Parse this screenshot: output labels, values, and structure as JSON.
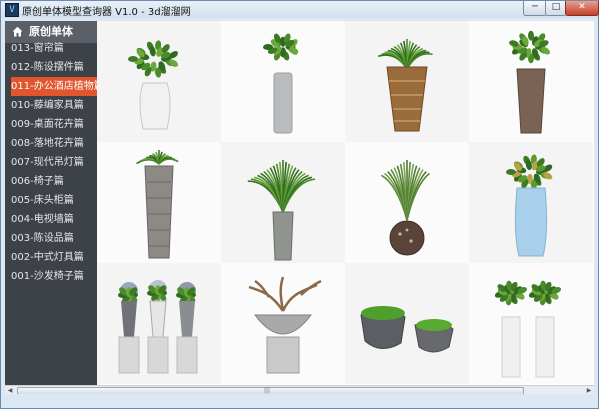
{
  "window": {
    "title": "原创单体模型查询器 V1.0 - 3d溜溜网",
    "min_glyph": "─",
    "max_glyph": "□",
    "close_glyph": "✕"
  },
  "sidebar": {
    "header": "原创单体",
    "header_icon": "house-icon",
    "items": [
      {
        "label": "013-窗帘篇",
        "active": false
      },
      {
        "label": "012-陈设摆件篇",
        "active": false
      },
      {
        "label": "011-办公酒店植物篇",
        "active": true
      },
      {
        "label": "010-藤编家具篇",
        "active": false
      },
      {
        "label": "009-桌面花卉篇",
        "active": false
      },
      {
        "label": "008-落地花卉篇",
        "active": false
      },
      {
        "label": "007-现代吊灯篇",
        "active": false
      },
      {
        "label": "006-椅子篇",
        "active": false
      },
      {
        "label": "005-床头柜篇",
        "active": false
      },
      {
        "label": "004-电视墙篇",
        "active": false
      },
      {
        "label": "003-陈设品篇",
        "active": false
      },
      {
        "label": "002-中式灯具篇",
        "active": false
      },
      {
        "label": "001-沙发椅子篇",
        "active": false
      }
    ]
  },
  "thumbnails": [
    {
      "name": "white-vase-plant"
    },
    {
      "name": "gray-cylinder-plant"
    },
    {
      "name": "wood-vase-grass"
    },
    {
      "name": "brown-vase-plant"
    },
    {
      "name": "textured-tall-vase-grass"
    },
    {
      "name": "gray-vase-palm"
    },
    {
      "name": "round-pot-palm"
    },
    {
      "name": "blue-vase-plant"
    },
    {
      "name": "hydrangea-pedestals"
    },
    {
      "name": "driftwood-bowl"
    },
    {
      "name": "moss-stones"
    },
    {
      "name": "topiary-white-pillars"
    }
  ],
  "colors": {
    "sidebar_bg": "#3d4148",
    "active_item": "#e2562d",
    "header_bg": "#5b6068"
  },
  "scrollbar": {
    "grip": "|||"
  }
}
